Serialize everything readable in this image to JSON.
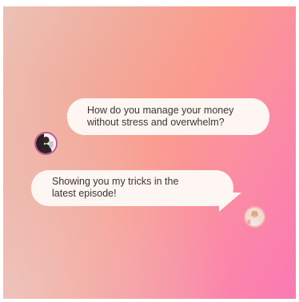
{
  "messages": [
    {
      "sender": "left",
      "lines": [
        "How do you manage your money",
        "without stress and overwhelm?"
      ]
    },
    {
      "sender": "right",
      "lines": [
        "Showing you my tricks in the",
        "latest episode!"
      ]
    }
  ],
  "avatars": {
    "first": "person-photo-avatar",
    "second": "person-photo-avatar"
  },
  "colors": {
    "bubble": "#fdf6f3",
    "text": "#3b3535",
    "gradient_start": "#ebc2b6",
    "gradient_end": "#fb79b3"
  }
}
